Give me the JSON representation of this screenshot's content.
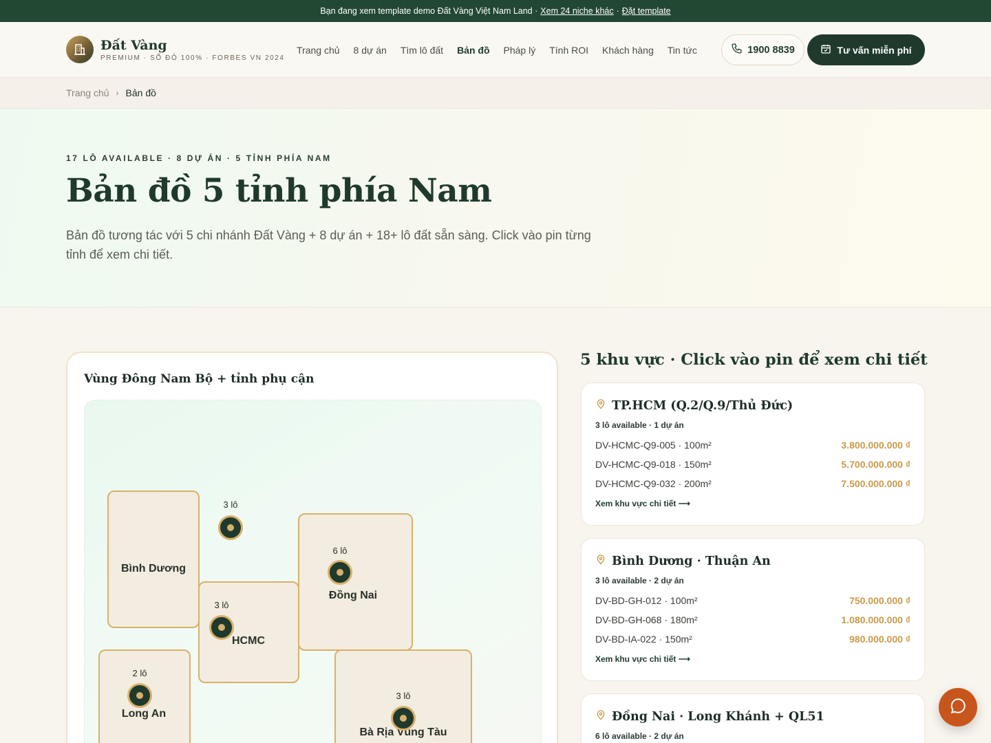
{
  "topbar": {
    "text": "Bạn đang xem template demo Đất Vàng Việt Nam Land ·",
    "link1": "Xem 24 niche khác",
    "sep": "·",
    "link2": "Đặt template"
  },
  "brand": {
    "name": "Đất Vàng",
    "tagline": "PREMIUM · SỔ ĐỎ 100% · FORBES VN 2024"
  },
  "nav": {
    "items": [
      "Trang chủ",
      "8 dự án",
      "Tìm lô đất",
      "Bản đồ",
      "Pháp lý",
      "Tính ROI",
      "Khách hàng",
      "Tin tức"
    ],
    "active_index": 3,
    "phone": "1900 8839",
    "cta": "Tư vấn miễn phí"
  },
  "breadcrumb": {
    "home": "Trang chủ",
    "current": "Bản đồ"
  },
  "hero": {
    "kicker": "17 LÔ AVAILABLE · 8 DỰ ÁN · 5 TỈNH PHÍA NAM",
    "title": "Bản đồ 5 tỉnh phía Nam",
    "desc": "Bản đồ tương tác với 5 chi nhánh Đất Vàng + 8 dự án + 18+ lô đất sẵn sàng. Click vào pin từng tỉnh để xem chi tiết."
  },
  "map": {
    "title": "Vùng Đông Nam Bộ + tỉnh phụ cận",
    "regions": [
      {
        "label": "Bình Dương"
      },
      {
        "label": "HCMC"
      },
      {
        "label": "Đồng Nai"
      },
      {
        "label": "Long An"
      },
      {
        "label": "Bà Rịa Vũng Tàu"
      }
    ],
    "pins": [
      {
        "count": "3 lô"
      },
      {
        "count": "3 lô"
      },
      {
        "count": "6 lô"
      },
      {
        "count": "2 lô"
      },
      {
        "count": "3 lô"
      }
    ]
  },
  "side": {
    "title": "5 khu vực · Click vào pin để xem chi tiết",
    "more_label": "Xem khu vực chi tiết ⟶",
    "areas": [
      {
        "name": "TP.HCM (Q.2/Q.9/Thủ Đức)",
        "meta": "3 lô available · 1 dự án",
        "lots": [
          {
            "code": "DV-HCMC-Q9-005 · 100m²",
            "price": "3.800.000.000 ₫"
          },
          {
            "code": "DV-HCMC-Q9-018 · 150m²",
            "price": "5.700.000.000 ₫"
          },
          {
            "code": "DV-HCMC-Q9-032 · 200m²",
            "price": "7.500.000.000 ₫"
          }
        ]
      },
      {
        "name": "Bình Dương · Thuận An",
        "meta": "3 lô available · 2 dự án",
        "lots": [
          {
            "code": "DV-BD-GH-012 · 100m²",
            "price": "750.000.000 ₫"
          },
          {
            "code": "DV-BD-GH-068 · 180m²",
            "price": "1.080.000.000 ₫"
          },
          {
            "code": "DV-BD-IA-022 · 150m²",
            "price": "980.000.000 ₫"
          }
        ]
      },
      {
        "name": "Đồng Nai · Long Khánh + QL51",
        "meta": "6 lô available · 2 dự án",
        "lots": []
      }
    ]
  },
  "colors": {
    "brand_green": "#1f3a2c",
    "gold": "#d9b06a",
    "price_gold": "#c99a49",
    "chat_orange": "#c8561c"
  }
}
